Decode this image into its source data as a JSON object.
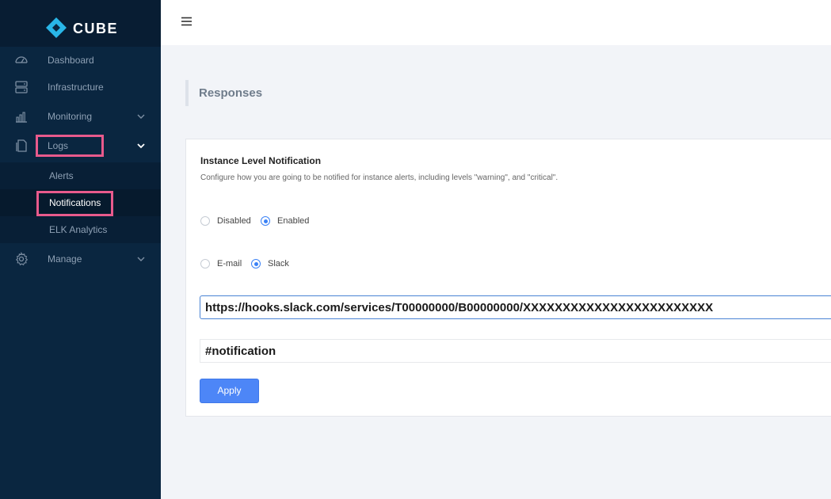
{
  "brand": {
    "name": "CUBE"
  },
  "sidebar": {
    "items": [
      {
        "label": "Dashboard",
        "icon": "dashboard-icon"
      },
      {
        "label": "Infrastructure",
        "icon": "server-icon"
      },
      {
        "label": "Monitoring",
        "icon": "bar-chart-icon",
        "expandable": true
      },
      {
        "label": "Logs",
        "icon": "document-icon",
        "expanded": true,
        "children": [
          {
            "label": "Alerts"
          },
          {
            "label": "Notifications",
            "active": true
          },
          {
            "label": "ELK Analytics"
          }
        ]
      },
      {
        "label": "Manage",
        "icon": "gear-icon",
        "expandable": true
      }
    ]
  },
  "page": {
    "title": "Responses"
  },
  "notification": {
    "title": "Instance Level Notification",
    "description": "Configure how you are going to be notified for instance alerts, including levels \"warning\", and \"critical\".",
    "state_options": [
      {
        "label": "Disabled",
        "checked": false
      },
      {
        "label": "Enabled",
        "checked": true
      }
    ],
    "channel_options": [
      {
        "label": "E-mail",
        "checked": false
      },
      {
        "label": "Slack",
        "checked": true
      }
    ],
    "webhook_value": "https://hooks.slack.com/services/T00000000/B00000000/XXXXXXXXXXXXXXXXXXXXXXXX",
    "channel_value": "#notification",
    "apply_label": "Apply"
  },
  "colors": {
    "sidebar_bg": "#0a2640",
    "accent": "#4d86f7",
    "highlight": "#e85a8c",
    "brand_cyan": "#29b6e8"
  }
}
